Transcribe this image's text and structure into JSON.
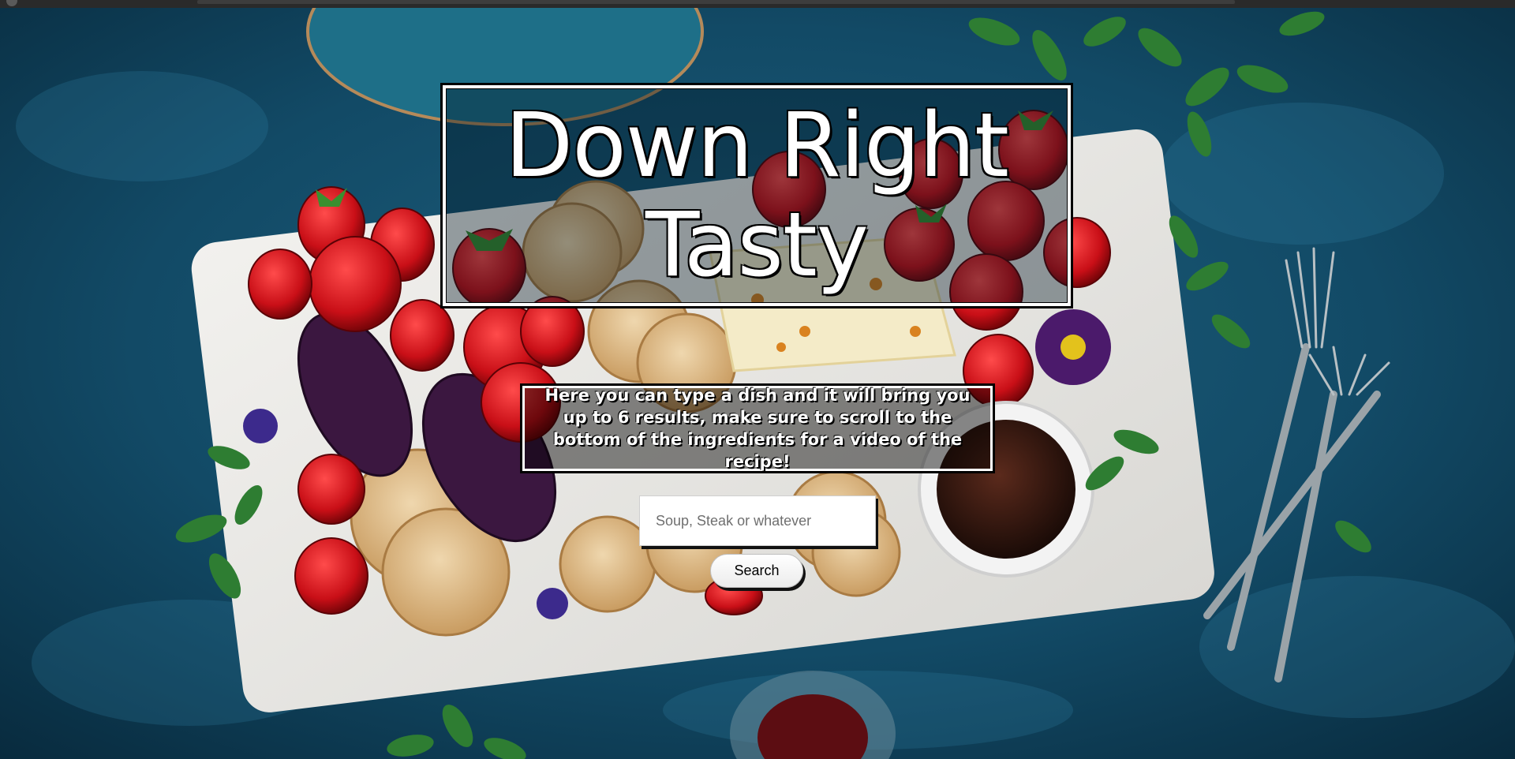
{
  "hero": {
    "title_line_1": "Down Right",
    "title_line_2": "Tasty",
    "description": "Here you can type a dish and it will bring you up to 6 results, make sure to scroll to the bottom of the ingredients for a video of the recipe!"
  },
  "search": {
    "placeholder": "Soup, Steak or whatever",
    "value": "",
    "button_label": "Search"
  },
  "colors": {
    "background": "#0f3a52",
    "title_text": "#ffffff",
    "outline": "#000000"
  },
  "icons": {
    "background_image": "food-board-photo"
  }
}
